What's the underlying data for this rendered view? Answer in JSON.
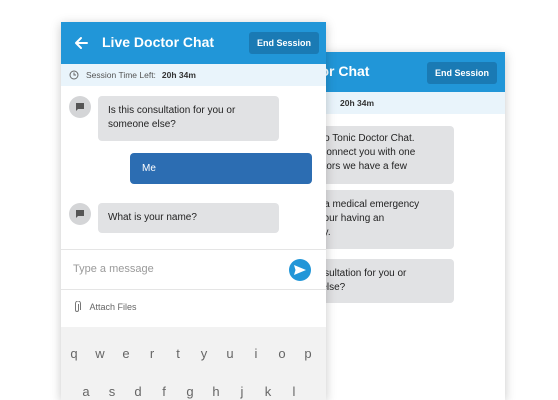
{
  "back_screen": {
    "title": "ctor Chat",
    "end_button": "End Session",
    "time_value": "20h 34m",
    "messages": [
      {
        "lines": [
          "e to Tonic Doctor Chat.",
          "e connect you with one",
          "octors we have a few"
        ]
      },
      {
        "lines": [
          "ot a medical emergency",
          "f your having an",
          "ncy."
        ]
      },
      {
        "lines": [
          "onsultation for you or",
          "e else?"
        ]
      }
    ]
  },
  "front_screen": {
    "title": "Live Doctor Chat",
    "end_button": "End Session",
    "time_label": "Session Time Left:",
    "time_value": "20h 34m",
    "messages": [
      {
        "lines": [
          "Is this consultation for you or",
          "someone else?"
        ]
      },
      {
        "lines": [
          "Me"
        ]
      },
      {
        "lines": [
          "What is your name?"
        ]
      }
    ],
    "input_placeholder": "Type a message",
    "attach_label": "Attach Files",
    "keyboard_row1": [
      "q",
      "w",
      "e",
      "r",
      "t",
      "y",
      "u",
      "i",
      "o",
      "p"
    ],
    "keyboard_row2": [
      "a",
      "s",
      "d",
      "f",
      "g",
      "h",
      "j",
      "k",
      "l"
    ]
  },
  "colors": {
    "appbar": "#2196d8",
    "end_button": "#1a7ab4",
    "user_bubble": "#2c6db2",
    "doctor_bubble": "#e1e2e4"
  }
}
